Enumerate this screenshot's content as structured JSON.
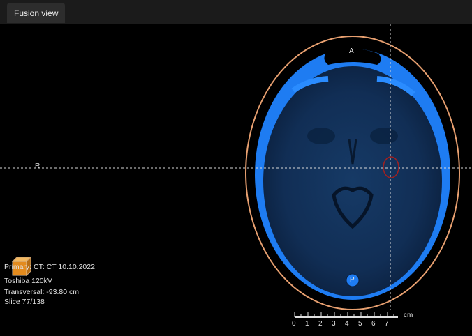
{
  "tab": {
    "label": "Fusion view"
  },
  "orientation": {
    "anterior": "A",
    "posterior": "P",
    "right": "R"
  },
  "info": {
    "primary": "Primary: CT: CT 10.10.2022",
    "scanner": "Toshiba 120kV",
    "position": "Transversal: -93.80 cm",
    "slice": "Slice 77/138"
  },
  "scale": {
    "unit": "cm",
    "ticks": [
      "0",
      "1",
      "2",
      "3",
      "4",
      "5",
      "6",
      "7"
    ]
  },
  "colors": {
    "contour": "#e8a070",
    "bone": "#1e7cf2",
    "brain": "#102a4d",
    "crosshair": "#d9d9d9",
    "roi": "#a02020"
  }
}
